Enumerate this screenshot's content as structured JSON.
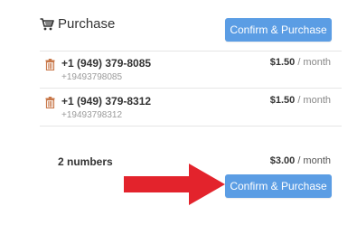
{
  "header": {
    "title": "Purchase",
    "cart_icon": "cart-icon",
    "confirm_label": "Confirm & Purchase"
  },
  "numbers": [
    {
      "number": "+1 (949) 379-8085",
      "raw": "+19493798085",
      "price": "$1.50",
      "period": "/ month"
    },
    {
      "number": "+1 (949) 379-8312",
      "raw": "+19493798312",
      "price": "$1.50",
      "period": "/ month"
    }
  ],
  "summary": {
    "count_label": "2 numbers",
    "total": "$3.00",
    "period": "/ month",
    "confirm_label": "Confirm & Purchase"
  },
  "colors": {
    "accent": "#5b9de4",
    "trash": "#c8784a",
    "arrow": "#e3232c"
  }
}
